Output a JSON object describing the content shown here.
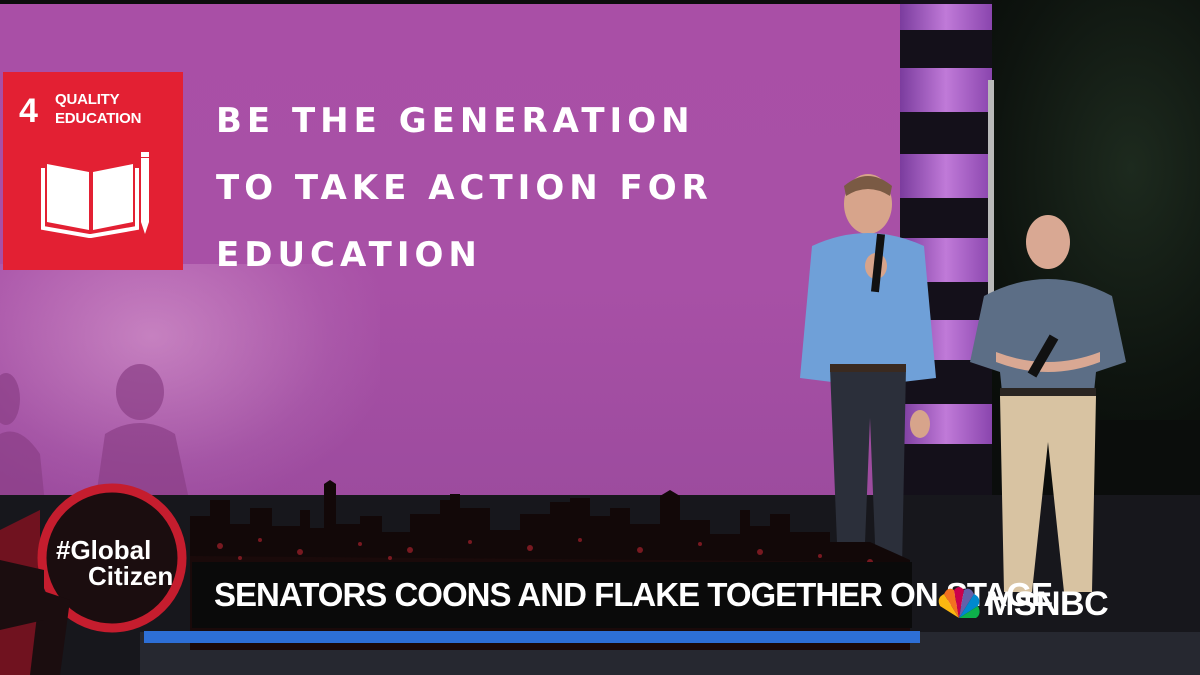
{
  "sdg": {
    "number": "4",
    "title_line1": "QUALITY",
    "title_line2": "EDUCATION",
    "icon": "book-pencil-icon",
    "color": "#e32033"
  },
  "screen": {
    "lines": [
      "BE THE GENERATION",
      "TO TAKE ACTION FOR",
      "EDUCATION"
    ],
    "color": "#a94fa6"
  },
  "lower_third": {
    "badge_line1": "#Global",
    "badge_line2": "Citizen",
    "headline": "SENATORS COONS AND FLAKE TOGETHER ON STAGE",
    "accent": "#2d6fd6"
  },
  "network": {
    "logo_text": "MSNBC",
    "icon": "peacock-icon"
  }
}
